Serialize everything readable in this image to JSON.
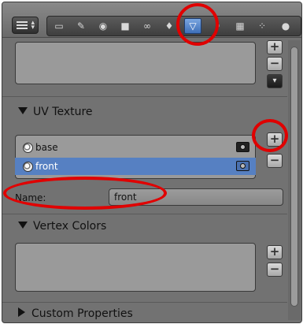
{
  "header": {
    "tabs": [
      {
        "icon": "render-icon",
        "glyph": "▭"
      },
      {
        "icon": "render-layers-icon",
        "glyph": "✎"
      },
      {
        "icon": "world-icon",
        "glyph": "◉"
      },
      {
        "icon": "object-icon",
        "glyph": "■"
      },
      {
        "icon": "constraints-icon",
        "glyph": "∞"
      },
      {
        "icon": "modifiers-icon",
        "glyph": "♦"
      },
      {
        "icon": "object-data-icon",
        "glyph": "▽"
      },
      {
        "icon": "material-icon",
        "glyph": "◦"
      },
      {
        "icon": "texture-icon",
        "glyph": "▦"
      },
      {
        "icon": "particles-icon",
        "glyph": "⁘"
      },
      {
        "icon": "physics-icon",
        "glyph": "●"
      }
    ],
    "active_tab_index": 6
  },
  "uv_texture": {
    "title": "UV Texture",
    "items": [
      {
        "label": "base",
        "selected": false
      },
      {
        "label": "front",
        "selected": true
      }
    ],
    "name_label": "Name:",
    "name_value": "front"
  },
  "vertex_colors": {
    "title": "Vertex Colors"
  },
  "custom_properties": {
    "title": "Custom Properties"
  },
  "buttons": {
    "add": "+",
    "remove": "−",
    "more": "▾"
  },
  "colors": {
    "highlight_ring": "#e00000",
    "selection": "#5680c2"
  }
}
